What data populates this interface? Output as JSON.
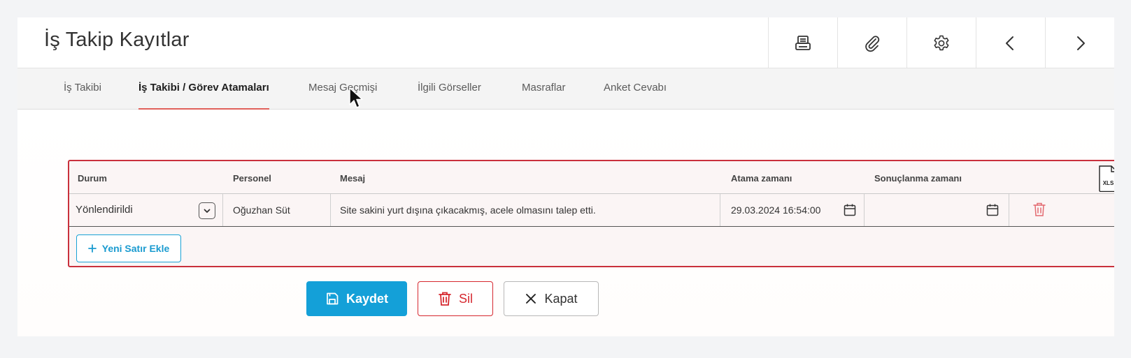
{
  "header": {
    "title": "İş Takip Kayıtlar"
  },
  "toolbar": {
    "buttons": [
      {
        "icon": "printer-icon"
      },
      {
        "icon": "paperclip-icon"
      },
      {
        "icon": "gear-icon"
      },
      {
        "icon": "chevron-left-icon"
      },
      {
        "icon": "chevron-right-icon"
      }
    ]
  },
  "tabs": [
    {
      "label": "İş Takibi"
    },
    {
      "label": "İş Takibi / Görev Atamaları",
      "active": true
    },
    {
      "label": "Mesaj Geçmişi"
    },
    {
      "label": "İlgili Görseller"
    },
    {
      "label": "Masraflar"
    },
    {
      "label": "Anket Cevabı"
    }
  ],
  "grid": {
    "columns": [
      "Durum",
      "Personel",
      "Mesaj",
      "Atama zamanı",
      "Sonuçlanma zamanı"
    ],
    "export_icon_text": "XLS",
    "rows": [
      {
        "durum": "Yönlendirildi",
        "personel": "Oğuzhan Süt",
        "mesaj": "Site sakini yurt dışına çıkacakmış, acele olmasını talep etti.",
        "atama_zamani": "29.03.2024 16:54:00",
        "sonuclanma_zamani": ""
      }
    ],
    "add_row_label": "Yeni Satır Ekle"
  },
  "footer": {
    "save_label": "Kaydet",
    "delete_label": "Sil",
    "close_label": "Kapat"
  },
  "colors": {
    "accent_blue": "#14a0d8",
    "danger_red": "#d6282f",
    "grid_border": "#c9303c",
    "tab_underline": "#e0605a"
  }
}
